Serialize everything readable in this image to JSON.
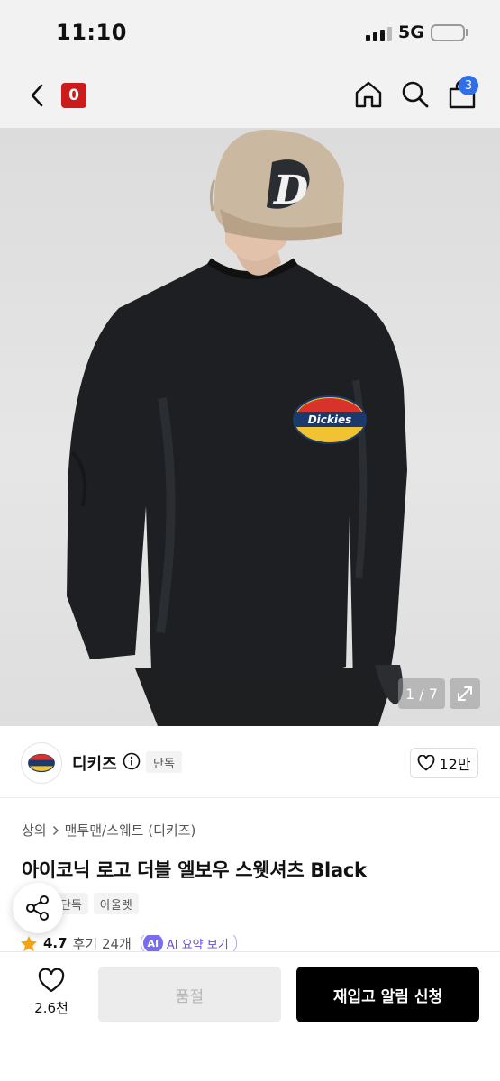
{
  "status_bar": {
    "time": "11:10",
    "network": "5G"
  },
  "nav": {
    "brand_logo_text": "0",
    "cart_count": "3"
  },
  "hero": {
    "counter": "1 / 7",
    "logo_text": "Dickies",
    "cap_letter": "D"
  },
  "brand": {
    "name": "디키즈",
    "exclusive_tag": "단독",
    "like_count": "12만"
  },
  "product": {
    "breadcrumb": {
      "category": "상의",
      "subcategory": "맨투맨/스웨트 (디키즈)"
    },
    "title": "아이코닉 로고 더블 엘보우 스웻셔츠 Black",
    "tags": [
      "단독",
      "아울렛"
    ],
    "rating": {
      "score": "4.7",
      "reviews": "후기 24개",
      "ai_label": "AI",
      "ai_text": "AI 요약 보기"
    }
  },
  "bottom_bar": {
    "wish_count": "2.6천",
    "soldout_label": "품절",
    "notify_label": "재입고 알림 신청"
  },
  "colors": {
    "brand_red": "#cc1b1b",
    "badge_blue": "#2f6fea",
    "ai_purple": "#7a6cf0"
  }
}
